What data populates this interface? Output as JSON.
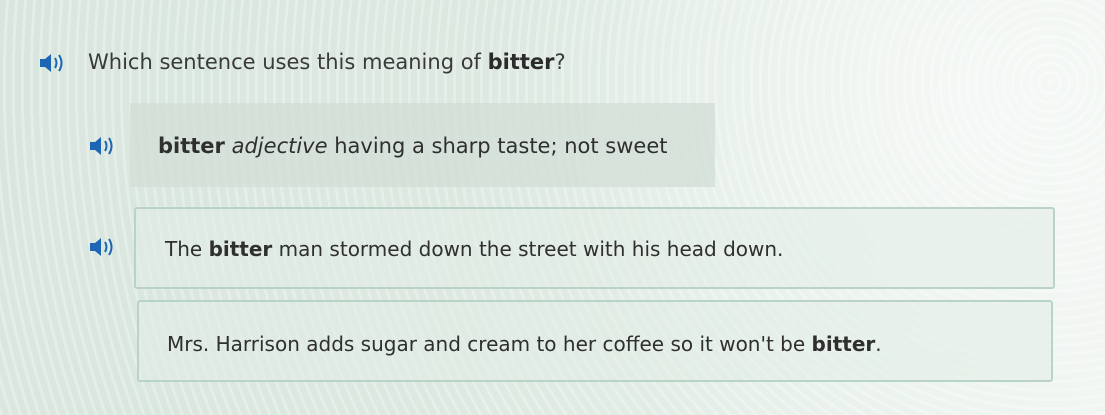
{
  "question": {
    "prefix": "Which sentence uses this meaning of ",
    "word": "bitter",
    "suffix": "?"
  },
  "definition": {
    "word": "bitter",
    "part_of_speech": "adjective",
    "meaning": "having a sharp taste; not sweet"
  },
  "answers": [
    {
      "before": "The ",
      "word": "bitter",
      "after": " man stormed down the street with his head down."
    },
    {
      "before": "Mrs. Harrison adds sugar and cream to her coffee so it won't be ",
      "word": "bitter",
      "after": "."
    }
  ],
  "icons": {
    "speaker": "speaker-icon"
  },
  "colors": {
    "speaker": "#1c66b4",
    "answer_border": "#b9d3c6"
  }
}
